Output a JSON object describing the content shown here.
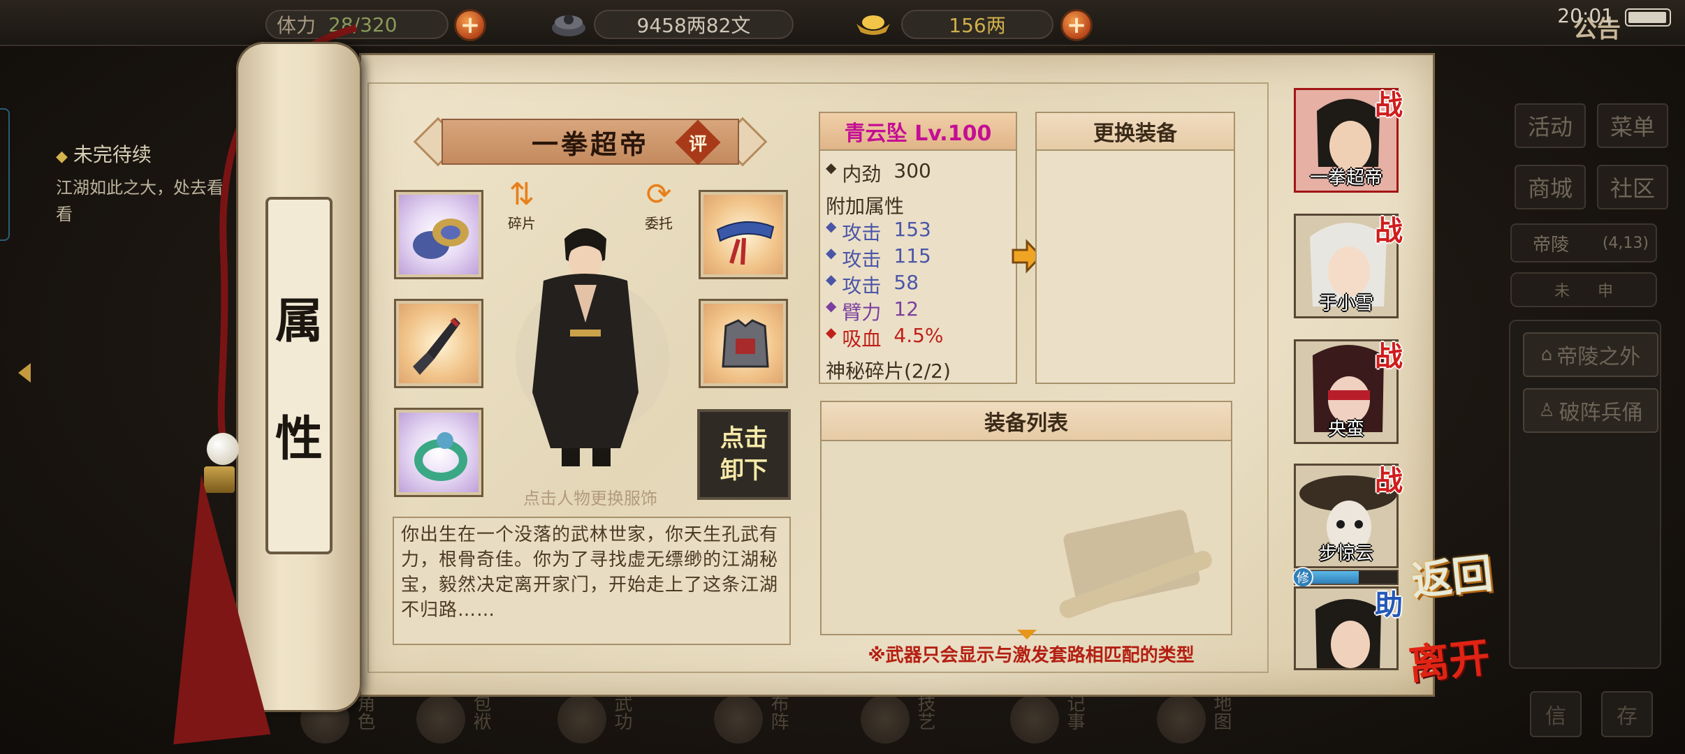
{
  "topbar": {
    "vitality_label": "体力",
    "vitality_value": "28/320",
    "money": "9458两82文",
    "gold": "156两",
    "notice": "公告",
    "time": "20:01"
  },
  "quest": {
    "title": "未完待续",
    "desc": "江湖如此之大，处去看看"
  },
  "right_menu": {
    "activity": "活动",
    "menu": "菜单",
    "shop": "商城",
    "community": "社区",
    "location": "帝陵",
    "coords": "(4,13)",
    "compass_a": "未",
    "compass_b": "申",
    "btn_outside": "帝陵之外",
    "btn_soldier": "破阵兵俑",
    "mini_a": "信",
    "mini_b": "存"
  },
  "bottom_nav": [
    {
      "label": "角色",
      "icon": "role-icon"
    },
    {
      "label": "包袱",
      "icon": "bag-icon"
    },
    {
      "label": "武功",
      "icon": "martial-arts-icon"
    },
    {
      "label": "布阵",
      "icon": "formation-icon"
    },
    {
      "label": "技艺",
      "icon": "skills-icon"
    },
    {
      "label": "记事",
      "icon": "journal-icon"
    },
    {
      "label": "地图",
      "icon": "map-icon"
    }
  ],
  "scroll": {
    "tab_char1": "属",
    "tab_char2": "性"
  },
  "character": {
    "name": "一拳超帝",
    "rating": "评",
    "fragment_label": "碎片",
    "entrust_label": "委托",
    "unequip_line1": "点击",
    "unequip_line2": "卸下",
    "outfit_hint": "点击人物更换服饰",
    "bio": "你出生在一个没落的武林世家，你天生孔武有力，根骨奇佳。你为了寻找虚无缥缈的江湖秘宝，毅然决定离开家门，开始走上了这条江湖不归路……"
  },
  "equipment_slots": [
    {
      "name": "gauntlet-item",
      "rarity": "purple"
    },
    {
      "name": "headband-item",
      "rarity": "orange"
    },
    {
      "name": "blade-item",
      "rarity": "orange"
    },
    {
      "name": "armor-item",
      "rarity": "orange"
    },
    {
      "name": "jade-ring-item",
      "rarity": "purple"
    }
  ],
  "item_stats": {
    "title": "青云坠 Lv.100",
    "base_label": "内劲",
    "base_value": "300",
    "extra_header": "附加属性",
    "attrs": [
      {
        "name": "攻击",
        "value": "153",
        "color": "#4a55a8"
      },
      {
        "name": "攻击",
        "value": "115",
        "color": "#4a55a8"
      },
      {
        "name": "攻击",
        "value": "58",
        "color": "#4a55a8"
      },
      {
        "name": "臂力",
        "value": "12",
        "color": "#7a3fa0"
      },
      {
        "name": "吸血",
        "value": "4.5%",
        "color": "#c0201a"
      }
    ],
    "fragment": "神秘碎片(2/2)"
  },
  "change_equipment": {
    "title": "更换装备"
  },
  "equipment_list": {
    "title": "装备列表",
    "warning": "※武器只会显示与激发套路相匹配的类型"
  },
  "party": [
    {
      "name": "一拳超帝",
      "badge": "战"
    },
    {
      "name": "于小雪",
      "badge": "战"
    },
    {
      "name": "央蛮",
      "badge": "战"
    },
    {
      "name": "步惊云",
      "badge": "战"
    },
    {
      "name": "",
      "badge": "助"
    }
  ],
  "cultivation": {
    "tag": "修",
    "progress": 0.62
  },
  "actions": {
    "back": "返回",
    "leave": "离开"
  }
}
